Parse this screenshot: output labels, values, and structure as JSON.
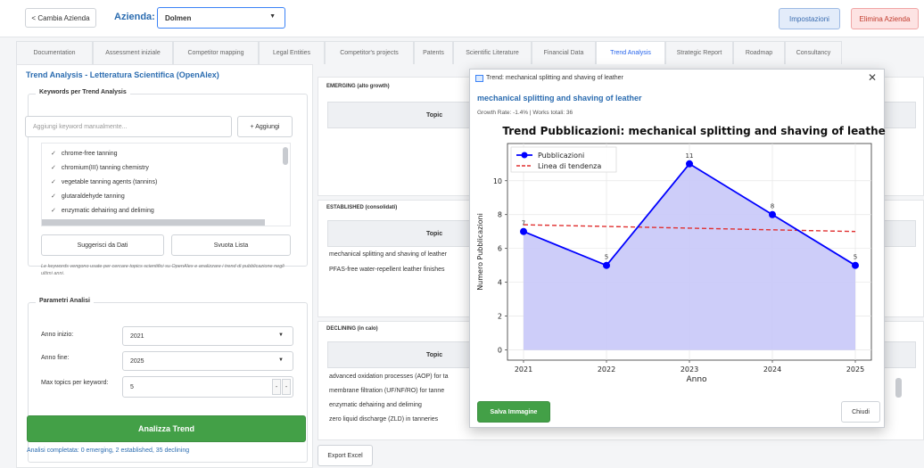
{
  "topbar": {
    "back_label": "< Cambia Azienda",
    "azienda_label": "Azienda:",
    "azienda_value": "Dolmen",
    "impostazioni_label": "Impostazioni",
    "elimina_label": "Elimina Azienda"
  },
  "tabs": [
    {
      "label": "Documentation"
    },
    {
      "label": "Assessment iniziale"
    },
    {
      "label": "Competitor mapping"
    },
    {
      "label": "Legal Entities"
    },
    {
      "label": "Competitor's projects"
    },
    {
      "label": "Patents"
    },
    {
      "label": "Scientific Literature"
    },
    {
      "label": "Financial Data"
    },
    {
      "label": "Trend Analysis",
      "active": true
    },
    {
      "label": "Strategic Report"
    },
    {
      "label": "Roadmap"
    },
    {
      "label": "Consultancy"
    }
  ],
  "left": {
    "title": "Trend Analysis - Letteratura Scientifica (OpenAlex)",
    "keywords_legend": "Keywords per Trend Analysis",
    "keyword_placeholder": "Aggiungi keyword manualmente...",
    "add_label": "+ Aggiungi",
    "keywords": [
      "chrome-free tanning",
      "chromium(III) tanning chemistry",
      "vegetable tanning agents (tannins)",
      "glutaraldehyde tanning",
      "enzymatic dehairing and deliming"
    ],
    "suggerisci_label": "Suggerisci da Dati",
    "svuota_label": "Svuota Lista",
    "hint": "Le keywords vengono usate per cercare topics scientifici su OpenAlex e analizzare i trend di pubblicazione negli ultimi anni.",
    "params_legend": "Parametri Analisi",
    "anno_inizio_label": "Anno inizio:",
    "anno_inizio_value": "2021",
    "anno_fine_label": "Anno fine:",
    "anno_fine_value": "2025",
    "max_topics_label": "Max topics per keyword:",
    "max_topics_value": "5",
    "analizza_label": "Analizza Trend",
    "status": "Analisi completata: 0 emerging, 2 established, 35 declining"
  },
  "middle": {
    "emerging_label": "EMERGING (alto growth)",
    "established_label": "ESTABLISHED (consolidati)",
    "declining_label": "DECLINING (in calo)",
    "topic_header": "Topic",
    "established_rows": [
      "mechanical splitting and shaving of leather",
      "PFAS-free water-repellent leather finishes"
    ],
    "declining_rows": [
      "advanced oxidation processes (AOP) for ta",
      "membrane filtration (UF/NF/RO) for tanne",
      "enzymatic dehairing and deliming",
      "zero liquid discharge (ZLD) in tanneries"
    ],
    "export_label": "Export Excel"
  },
  "modal": {
    "window_title": "Trend: mechanical splitting and shaving of leather",
    "heading": "mechanical splitting and shaving of leather",
    "meta": "Growth Rate: -1.4% | Works totali: 36",
    "salva_label": "Salva Immagine",
    "chiudi_label": "Chiudi"
  },
  "chart_data": {
    "type": "line",
    "title": "Trend Pubblicazioni: mechanical splitting and shaving of leather",
    "xlabel": "Anno",
    "ylabel": "Numero Pubblicazioni",
    "x": [
      2021,
      2022,
      2023,
      2024,
      2025
    ],
    "xlim": [
      2021,
      2025
    ],
    "ylim": [
      0,
      11
    ],
    "yticks": [
      0,
      2,
      4,
      6,
      8,
      10
    ],
    "grid": true,
    "legend_position": "top-left",
    "series": [
      {
        "name": "Pubblicazioni",
        "values": [
          7,
          5,
          11,
          8,
          5
        ],
        "color": "#0000ff",
        "fill": "#c8c8f8",
        "labels": [
          "7",
          "5",
          "11",
          "8",
          "5"
        ]
      },
      {
        "name": "Linea di tendenza",
        "values": [
          7.4,
          7.3,
          7.2,
          7.1,
          7.0
        ],
        "color": "#e03030",
        "dashed": true
      }
    ]
  }
}
